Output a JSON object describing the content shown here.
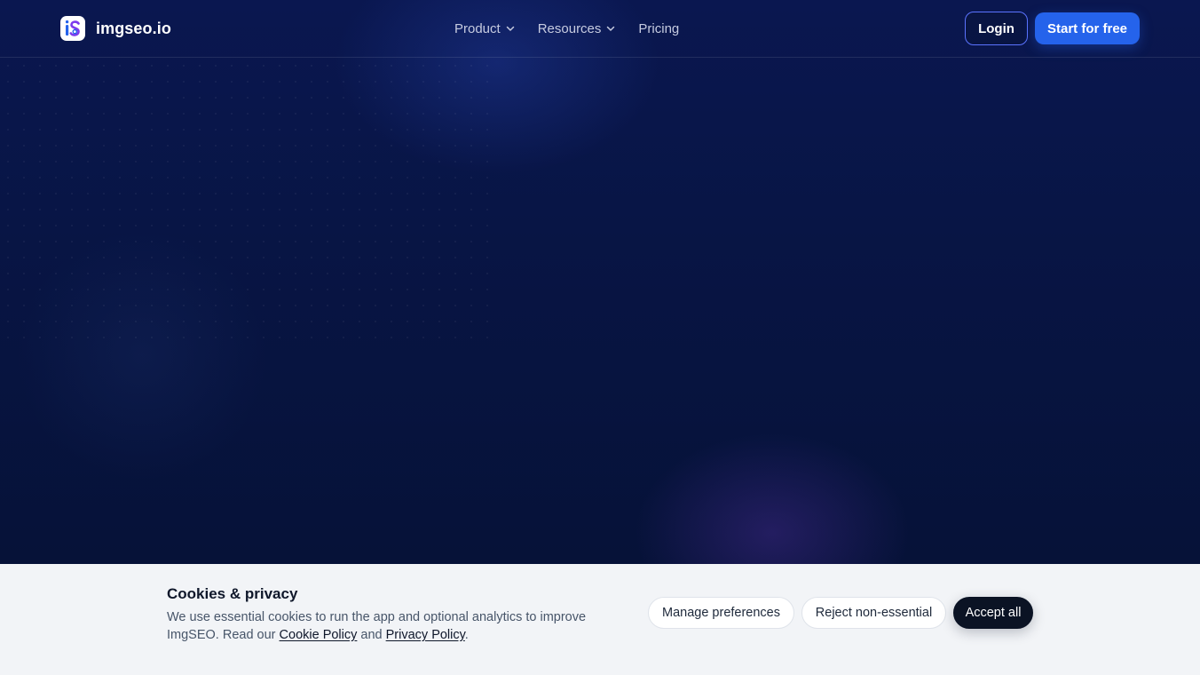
{
  "header": {
    "brand": "imgseo.io",
    "nav": [
      {
        "label": "Product",
        "has_dropdown": true
      },
      {
        "label": "Resources",
        "has_dropdown": true
      },
      {
        "label": "Pricing",
        "has_dropdown": false
      }
    ],
    "login_label": "Login",
    "cta_label": "Start for free"
  },
  "cookie_banner": {
    "title": "Cookies & privacy",
    "text_before": "We use essential cookies to run the app and optional analytics to improve ImgSEO. Read our ",
    "cookie_policy_link": "Cookie Policy",
    "text_and": " and ",
    "privacy_policy_link": "Privacy Policy",
    "text_end": ".",
    "manage_label": "Manage preferences",
    "reject_label": "Reject non-essential",
    "accept_label": "Accept all"
  },
  "colors": {
    "background": "#06133a",
    "primary": "#2563eb",
    "banner_background": "#f2f4f7",
    "accept_button": "#0b1324"
  },
  "icons": {
    "logo": "imgseo-logo-icon",
    "dropdown": "chevron-down-icon"
  }
}
